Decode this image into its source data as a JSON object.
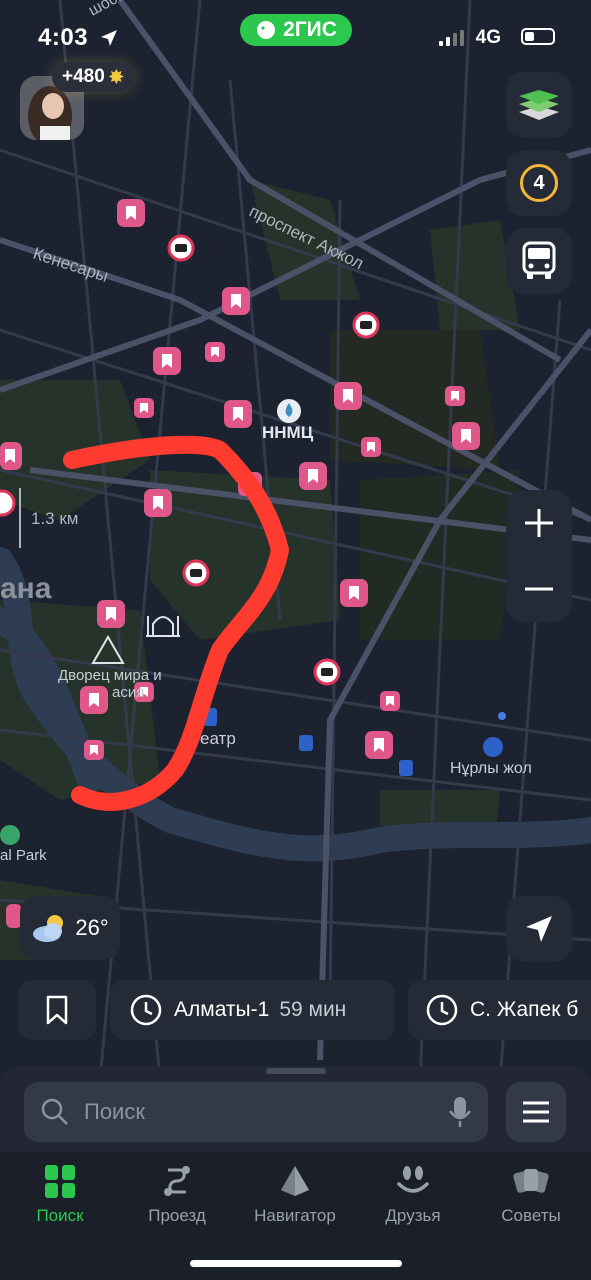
{
  "status_bar": {
    "time": "4:03",
    "network": "4G",
    "brand": "2ГИС"
  },
  "profile": {
    "points": "+480"
  },
  "map": {
    "labels": {
      "prospekt": "проспект Акжол",
      "kenesary": "Кенесары",
      "shosse": "шоссе",
      "nnmc": "ННМЦ",
      "dvorets": "Дворец мира и",
      "soglasiya": "асия",
      "teatr": "еатр",
      "nurly": "Нұрлы жол",
      "park": "al Park",
      "city": "ана"
    },
    "scale": "1.3 км"
  },
  "controls": {
    "traffic_level": "4"
  },
  "weather": {
    "temp": "26°"
  },
  "chips": [
    {
      "label": "Алматы-1",
      "minutes": "59 мин"
    },
    {
      "label": "С. Жапек б",
      "minutes": ""
    }
  ],
  "search": {
    "placeholder": "Поиск"
  },
  "tabs": [
    {
      "label": "Поиск"
    },
    {
      "label": "Проезд"
    },
    {
      "label": "Навигатор"
    },
    {
      "label": "Друзья"
    },
    {
      "label": "Советы"
    }
  ],
  "colors": {
    "accent": "#2cc84d",
    "marker": "#e0588a",
    "route": "#ff3b30",
    "traffic": "#f3b635"
  }
}
